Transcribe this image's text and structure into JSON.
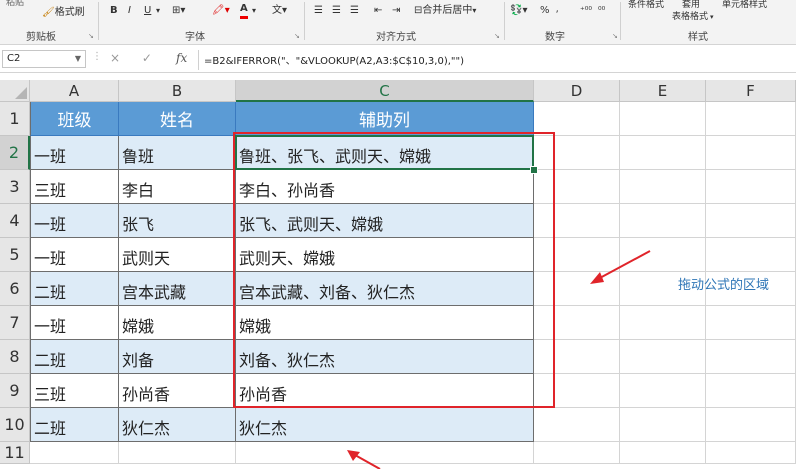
{
  "ribbon": {
    "clipboard": {
      "paste_partial": "粘贴",
      "format_painter": "格式刷",
      "group_label": "剪贴板"
    },
    "font": {
      "bold": "B",
      "italic": "I",
      "underline": "U",
      "group_label": "字体"
    },
    "alignment": {
      "merge_center": "合并后居中",
      "group_label": "对齐方式"
    },
    "number": {
      "percent": "%",
      "group_label": "数字"
    },
    "styles": {
      "conditional_format": "条件格式",
      "table_format_line1": "套用",
      "table_format_line2": "表格格式",
      "cell_styles": "单元格样式",
      "group_label": "样式"
    }
  },
  "formula_bar": {
    "name_box": "C2",
    "cancel": "×",
    "enter": "✓",
    "fx": "fx",
    "formula": "=B2&IFERROR(\"、\"&VLOOKUP(A2,A3:$C$10,3,0),\"\")"
  },
  "sheet": {
    "columns": [
      "A",
      "B",
      "C",
      "D",
      "E",
      "F"
    ],
    "rows": [
      "1",
      "2",
      "3",
      "4",
      "5",
      "6",
      "7",
      "8",
      "9",
      "10",
      "11"
    ],
    "header": {
      "a": "班级",
      "b": "姓名",
      "c": "辅助列"
    },
    "data": [
      {
        "a": "一班",
        "b": "鲁班",
        "c": "鲁班、张飞、武则天、嫦娥"
      },
      {
        "a": "三班",
        "b": "李白",
        "c": "李白、孙尚香"
      },
      {
        "a": "一班",
        "b": "张飞",
        "c": "张飞、武则天、嫦娥"
      },
      {
        "a": "一班",
        "b": "武则天",
        "c": "武则天、嫦娥"
      },
      {
        "a": "二班",
        "b": "宫本武藏",
        "c": "宫本武藏、刘备、狄仁杰"
      },
      {
        "a": "一班",
        "b": "嫦娥",
        "c": "嫦娥"
      },
      {
        "a": "二班",
        "b": "刘备",
        "c": "刘备、狄仁杰"
      },
      {
        "a": "三班",
        "b": "孙尚香",
        "c": "孙尚香"
      },
      {
        "a": "二班",
        "b": "狄仁杰",
        "c": "狄仁杰"
      }
    ]
  },
  "annotation": {
    "note": "拖动公式的区域",
    "color": "#e0242a",
    "note_color": "#2e75b6"
  },
  "colors": {
    "header_fill": "#5b9bd5",
    "band_fill": "#ddebf7",
    "active_border": "#217346"
  }
}
